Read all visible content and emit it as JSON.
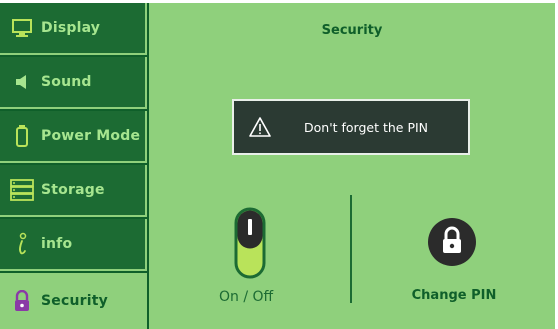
{
  "sidebar": {
    "items": [
      {
        "label": "Display",
        "icon": "monitor-icon"
      },
      {
        "label": "Sound",
        "icon": "speaker-icon"
      },
      {
        "label": "Power Mode",
        "icon": "battery-icon"
      },
      {
        "label": "Storage",
        "icon": "storage-icon"
      },
      {
        "label": "info",
        "icon": "info-icon"
      },
      {
        "label": "Security",
        "icon": "lock-icon",
        "active": true
      }
    ]
  },
  "main": {
    "title": "Security",
    "toast": {
      "message": "Don't forget the PIN",
      "icon": "warning-icon"
    },
    "toggle": {
      "label": "On / Off",
      "state": "on"
    },
    "change_pin": {
      "label": "Change PIN",
      "icon": "lock-icon"
    }
  },
  "colors": {
    "sidebar_bg": "#1c6b33",
    "sidebar_text": "#a6e58f",
    "main_bg": "#8fd07c",
    "accent_dark": "#0f5f2a",
    "toggle_fill": "#b9e35a",
    "toast_bg": "#2b3a33"
  }
}
